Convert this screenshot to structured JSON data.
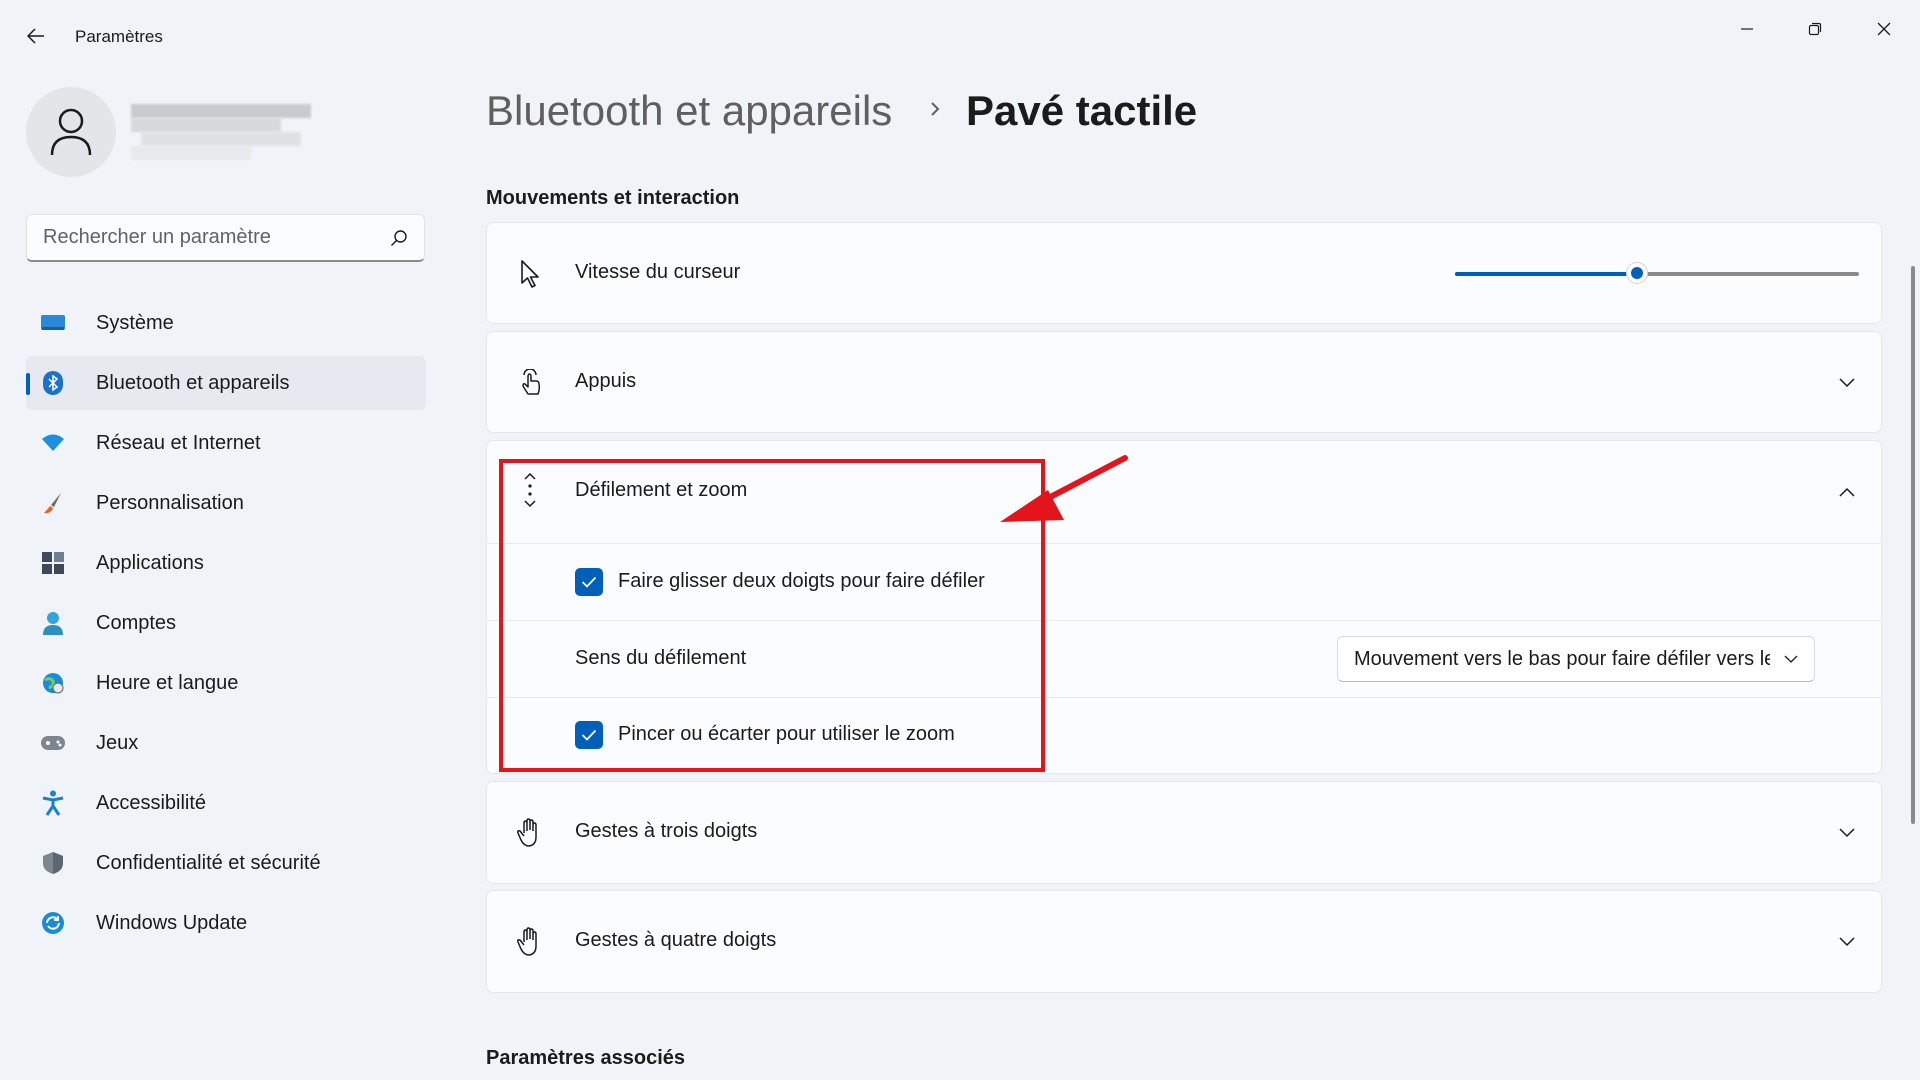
{
  "window": {
    "title": "Paramètres",
    "controls": [
      "minimize-icon",
      "restore-icon",
      "close-icon"
    ]
  },
  "search": {
    "placeholder": "Rechercher un paramètre"
  },
  "sidebar": {
    "items": [
      {
        "label": "Système",
        "icon": "system-icon"
      },
      {
        "label": "Bluetooth et appareils",
        "icon": "bluetooth-icon",
        "active": true
      },
      {
        "label": "Réseau et Internet",
        "icon": "wifi-icon"
      },
      {
        "label": "Personnalisation",
        "icon": "brush-icon"
      },
      {
        "label": "Applications",
        "icon": "apps-icon"
      },
      {
        "label": "Comptes",
        "icon": "account-icon"
      },
      {
        "label": "Heure et langue",
        "icon": "globe-clock-icon"
      },
      {
        "label": "Jeux",
        "icon": "gamepad-icon"
      },
      {
        "label": "Accessibilité",
        "icon": "accessibility-icon"
      },
      {
        "label": "Confidentialité et sécurité",
        "icon": "shield-icon"
      },
      {
        "label": "Windows Update",
        "icon": "update-icon"
      }
    ]
  },
  "breadcrumb": {
    "parent": "Bluetooth et appareils",
    "current": "Pavé tactile"
  },
  "section_title": "Mouvements et interaction",
  "cards": {
    "cursor_speed": {
      "label": "Vitesse du curseur",
      "value_fraction": 0.45
    },
    "taps": {
      "label": "Appuis"
    },
    "scroll_zoom": {
      "label": "Défilement et zoom",
      "two_finger_scroll": {
        "label": "Faire glisser deux doigts pour faire défiler",
        "checked": true
      },
      "scroll_direction": {
        "label": "Sens du défilement",
        "value": "Mouvement vers le bas pour faire défiler vers le haut"
      },
      "pinch_zoom": {
        "label": "Pincer ou écarter pour utiliser le zoom",
        "checked": true
      }
    },
    "three_finger": {
      "label": "Gestes à trois doigts"
    },
    "four_finger": {
      "label": "Gestes à quatre doigts"
    }
  },
  "related_title": "Paramètres associés",
  "colors": {
    "accent": "#005fb8",
    "highlight": "#e3141b",
    "background": "#f0f4f9"
  }
}
